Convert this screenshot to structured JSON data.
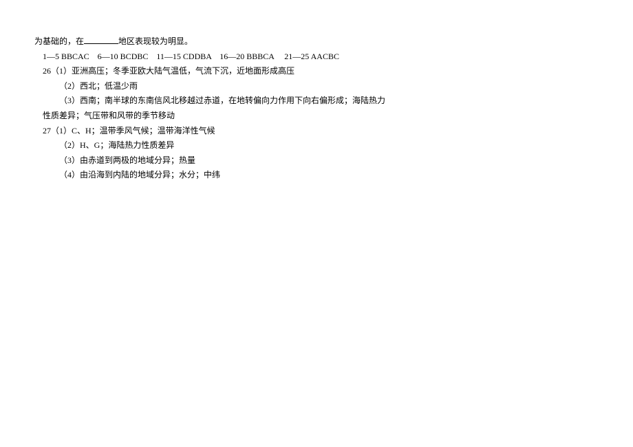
{
  "lines": [
    {
      "indent": 0,
      "text_parts": [
        "为基础的，在",
        "BLANK",
        "地区表现较为明显。"
      ]
    },
    {
      "indent": 1,
      "text_parts": [
        "1—5 BBCAC　6—10 BCDBC　11—15 CDDBA　16—20 BBBCA　 21—25 AACBC"
      ]
    },
    {
      "indent": 1,
      "text_parts": [
        "26（1）亚洲高压；冬季亚欧大陆气温低，气流下沉，近地面形成高压"
      ]
    },
    {
      "indent": 2,
      "text_parts": [
        "（2）西北；低温少雨"
      ]
    },
    {
      "indent": 2,
      "text_parts": [
        "（3）西南；南半球的东南信风北移越过赤道，在地转偏向力作用下向右偏形成；海陆热力"
      ]
    },
    {
      "indent": 1,
      "text_parts": [
        "性质差异；气压带和风带的季节移动"
      ]
    },
    {
      "indent": 1,
      "text_parts": [
        "27（1）C、H；温带季风气候；温带海洋性气候"
      ]
    },
    {
      "indent": 2,
      "text_parts": [
        "（2）H、G；海陆热力性质差异"
      ]
    },
    {
      "indent": 2,
      "text_parts": [
        "（3）由赤道到两极的地域分异；热量"
      ]
    },
    {
      "indent": 2,
      "text_parts": [
        "（4）由沿海到内陆的地域分异；水分；中纬"
      ]
    }
  ]
}
